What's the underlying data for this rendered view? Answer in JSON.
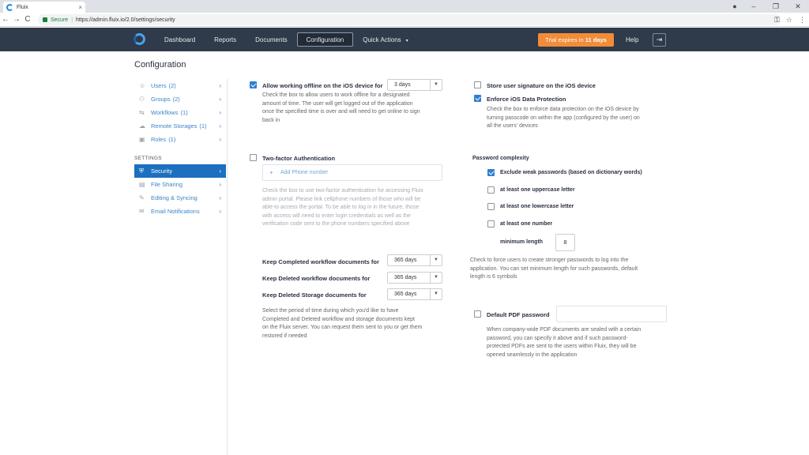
{
  "browser": {
    "tab_title": "Fluix",
    "tab_close": "×",
    "win_min": "–",
    "win_max": "❐",
    "win_close": "✕",
    "profile": "●",
    "back": "←",
    "forward": "→",
    "reload": "C",
    "secure": "Secure",
    "separator": "|",
    "url": "https://admin.fluix.io/2.0/settings/security",
    "key": "⚿",
    "star": "☆",
    "menu": "⋮"
  },
  "nav": {
    "items": [
      "Dashboard",
      "Reports",
      "Documents",
      "Configuration",
      "Quick Actions"
    ],
    "caret": "▾",
    "trial_prefix": "Trial expires in ",
    "trial_days": "11 days",
    "help": "Help",
    "logout": "⇥"
  },
  "page": {
    "title": "Configuration"
  },
  "sidebar": {
    "items": [
      {
        "label": "Users",
        "count": "(2)",
        "icon": "☺"
      },
      {
        "label": "Groups",
        "count": "(2)",
        "icon": "⚇"
      },
      {
        "label": "Workflows",
        "count": "(1)",
        "icon": "⇆"
      },
      {
        "label": "Remote Storages",
        "count": "(1)",
        "icon": "☁"
      },
      {
        "label": "Roles",
        "count": "(1)",
        "icon": "▣"
      }
    ],
    "section": "SETTINGS",
    "settings": [
      {
        "label": "Security",
        "icon": "⛨",
        "active": true
      },
      {
        "label": "File Sharing",
        "icon": "▤"
      },
      {
        "label": "Editing & Syncing",
        "icon": "✎"
      },
      {
        "label": "Email Notifications",
        "icon": "✉"
      }
    ],
    "chevron": "›"
  },
  "offline": {
    "label": "Allow working offline on the iOS device for",
    "value": "3 days",
    "arrow": "▼",
    "desc1": "Check the box to allow users to work offline for a designated",
    "desc2": "amount of time. The user will get logged out of the application",
    "desc3": "once the specified time is over and will need to get online to sign",
    "desc4": "back in",
    "checked": true
  },
  "twofa": {
    "label": "Two-factor Authentication",
    "add_plus": "+",
    "add_phone": "Add Phone number",
    "desc1": "Check the box to use two-factor authentication for accessing Fluix",
    "desc2": "admin portal. Please link cellphone numbers of those who will be",
    "desc3": "able to access the portal. To be able to log in in the future, those",
    "desc4": "with access will need to enter login credentials as well as the",
    "desc5": "verification code sent to the phone numbers specified above",
    "checked": false
  },
  "retention": {
    "completed_label": "Keep Completed workflow documents for",
    "completed_value": "365 days",
    "deleted_label": "Keep Deleted workflow documents for",
    "deleted_value": "365 days",
    "storage_label": "Keep Deleted Storage documents for",
    "storage_value": "365 days",
    "desc1": "Select the period of time during which you'd like to have",
    "desc2": "Completed and Deleted workflow and storage documents kept",
    "desc3": "on the Fluix server. You can request them sent to you or get them",
    "desc4": "restored if needed"
  },
  "signature": {
    "label": "Store user signature on the iOS device",
    "checked": false
  },
  "protection": {
    "label": "Enforce iOS Data Protection",
    "checked": true,
    "desc1": "Check the box to enforce data protection on the iOS device by",
    "desc2": "turning passcode on within the app (configured by the user) on",
    "desc3": "all the users' devices"
  },
  "password": {
    "title": "Password complexity",
    "weak": {
      "label": "Exclude weak passwords (based on dictionary words)",
      "checked": true
    },
    "upper": {
      "label": "at least one uppercase letter",
      "checked": false
    },
    "lower": {
      "label": "at least one lowercase letter",
      "checked": false
    },
    "number": {
      "label": "at least one number",
      "checked": false
    },
    "min_label": "minimum length",
    "min_value": "8",
    "desc1": "Check to force users to create stronger passwords to log into the",
    "desc2": "application. You can set minimum length for such passwords, default",
    "desc3": "length is 6 symbols"
  },
  "pdf": {
    "label": "Default PDF password",
    "value": "",
    "checked": false,
    "desc1": "When company-wide PDF documents are sealed with a certain",
    "desc2": "password, you can specify it above and if such password-",
    "desc3": "protected PDFs are sent to the users within Fluix, they will be",
    "desc4": "opened seamlessly in the application"
  }
}
